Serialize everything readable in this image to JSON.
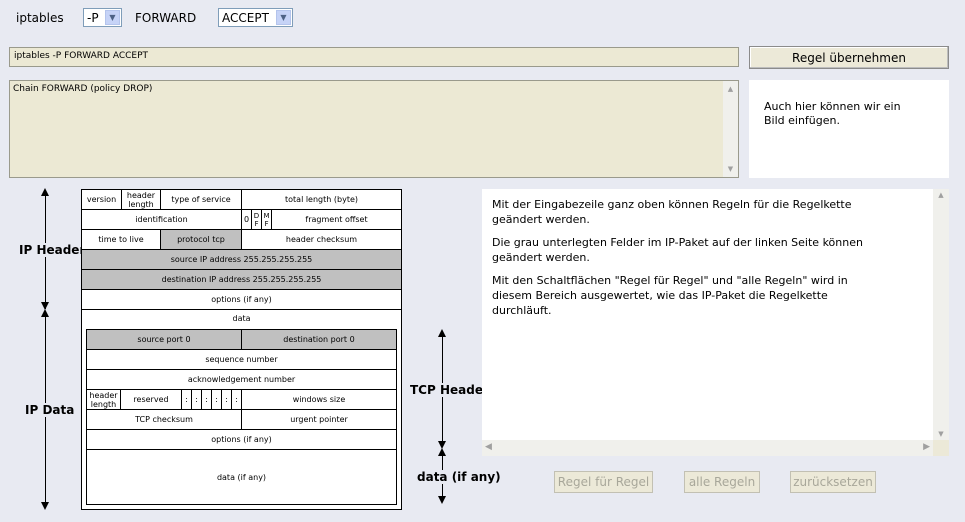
{
  "toolbar": {
    "iptables_label": "iptables",
    "policy_option": "-P",
    "chain_label": "FORWARD",
    "target_option": "ACCEPT"
  },
  "command": {
    "value": "iptables -P FORWARD ACCEPT",
    "apply_label": "Regel übernehmen"
  },
  "output": {
    "text": "Chain FORWARD (policy DROP)"
  },
  "image_box": {
    "text": "Auch hier können wir ein Bild einfügen."
  },
  "diagram": {
    "ip_header": "IP Header",
    "ip_data": "IP Data",
    "tcp_header": "TCP Header",
    "tcp_data": "data (if any)",
    "version": "version",
    "header_length": "header length",
    "type_of_service": "type of service",
    "total_length": "total length (byte)",
    "identification": "identification",
    "flag_zero": "0",
    "flag_df": "D F",
    "flag_mf": "M F",
    "fragment_offset": "fragment offset",
    "time_to_live": "time to live",
    "protocol": "protocol tcp",
    "header_checksum": "header checksum",
    "source_ip": "source IP address 255.255.255.255",
    "destination_ip": "destination IP address 255.255.255.255",
    "ip_options": "options (if any)",
    "data": "data",
    "source_port": "source port 0",
    "destination_port": "destination port 0",
    "sequence_number": "sequence number",
    "ack_number": "acknowledgement number",
    "tcp_header_length": "header length",
    "reserved": "reserved",
    "flag_dots": ":",
    "window_size": "windows size",
    "tcp_checksum": "TCP checksum",
    "urgent_pointer": "urgent pointer",
    "tcp_options": "options (if any)"
  },
  "info": {
    "p1": "Mit der Eingabezeile ganz oben können Regeln für die Regelkette geändert werden.",
    "p2": "Die grau unterlegten Felder im IP-Paket auf der linken Seite können geändert werden.",
    "p3": "Mit den Schaltflächen \"Regel für Regel\" und \"alle Regeln\" wird in diesem Bereich ausgewertet, wie das IP-Paket die Regelkette durchläuft."
  },
  "buttons": {
    "rule_by_rule": "Regel für Regel",
    "all_rules": "alle Regeln",
    "reset": "zurücksetzen"
  }
}
